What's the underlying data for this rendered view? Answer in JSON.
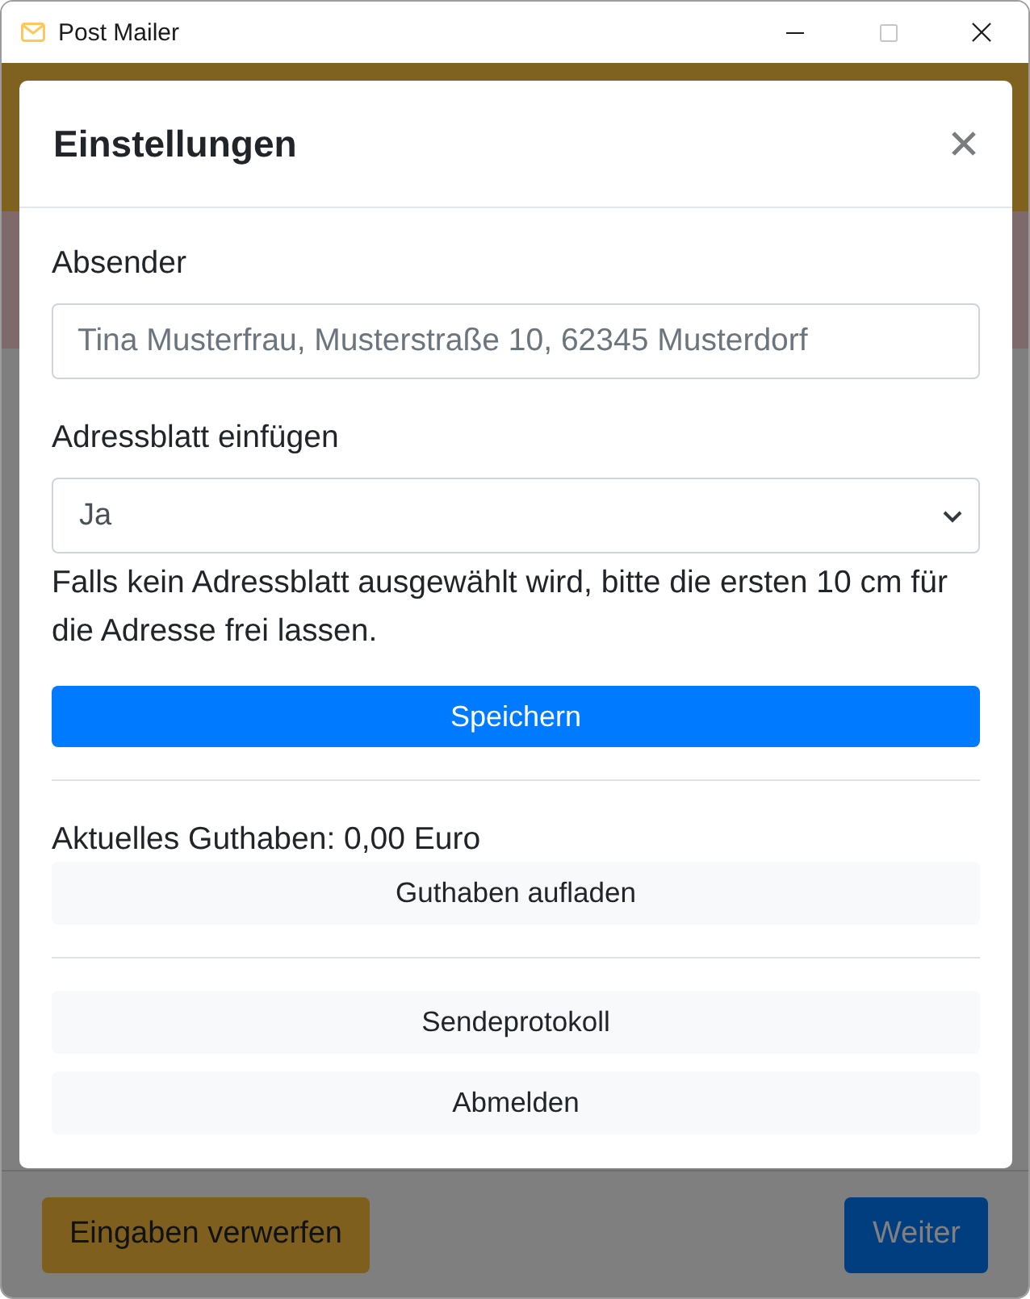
{
  "window": {
    "title": "Post Mailer",
    "maximize_disabled": true
  },
  "modal": {
    "title": "Einstellungen",
    "form": [
      {
        "kind": "text",
        "label": "Absender",
        "placeholder": "Tina Musterfrau, Musterstraße 10, 62345 Musterdorf"
      },
      {
        "kind": "select",
        "label": "Adressblatt einfügen",
        "value": "Ja",
        "help": "Falls kein Adressblatt ausgewählt wird, bitte die ersten 10 cm für die Adresse frei lassen."
      }
    ],
    "save_button": "Speichern",
    "balance": "Aktuelles Guthaben: 0,00 Euro",
    "topup_button": "Guthaben aufladen",
    "actions": [
      "Sendeprotokoll",
      "Abmelden"
    ]
  },
  "footer": {
    "discard_button": "Eingaben verwerfen",
    "next_button": "Weiter"
  }
}
